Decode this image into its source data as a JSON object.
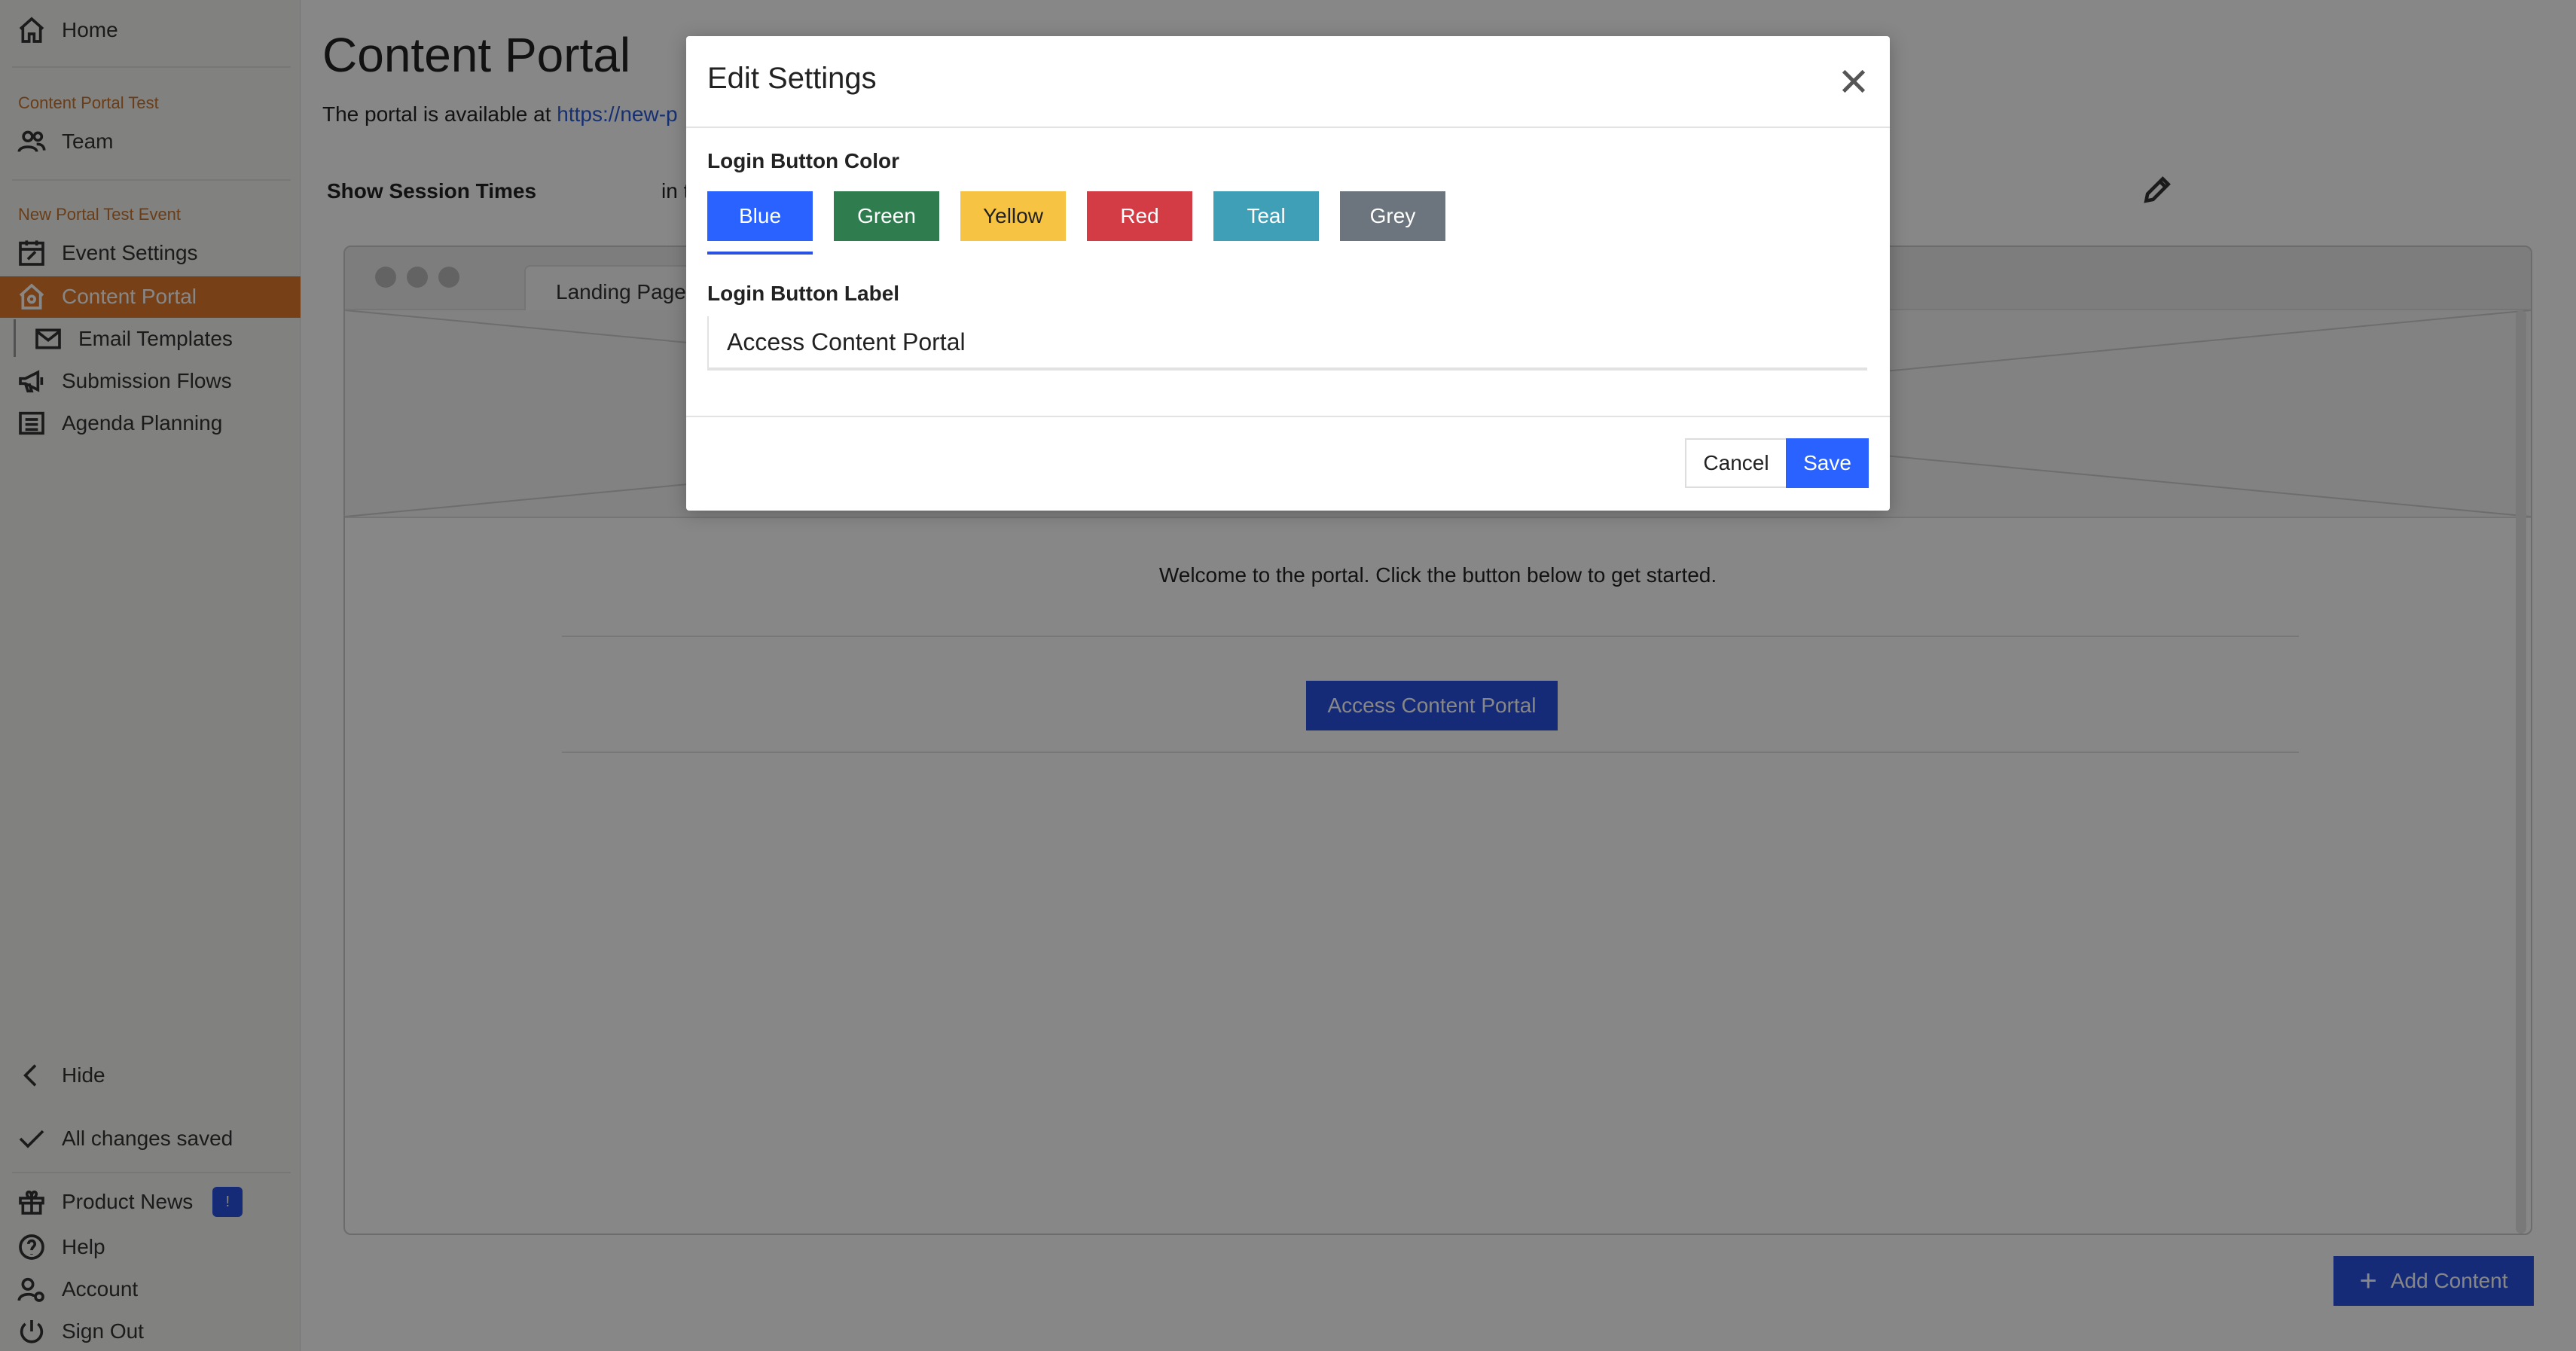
{
  "sidebar": {
    "home": "Home",
    "section1": "Content Portal Test",
    "team": "Team",
    "section2": "New Portal Test Event",
    "event_settings": "Event Settings",
    "content_portal": "Content Portal",
    "email_templates": "Email Templates",
    "submission_flows": "Submission Flows",
    "agenda_planning": "Agenda Planning",
    "hide": "Hide",
    "saved_status": "All changes saved",
    "product_news": "Product News",
    "product_news_badge": "!",
    "help": "Help",
    "account": "Account",
    "sign_out": "Sign Out",
    "accent_color": "#e07a2c"
  },
  "main": {
    "title": "Content Portal",
    "portal_text": "The portal is available at ",
    "portal_link": "https://new-p",
    "session_label": "Show Session Times",
    "session_in": "in t",
    "preview": {
      "tab_label": "Landing Page",
      "welcome_text": "Welcome to the portal. Click the button below to get started.",
      "portal_button": "Access Content Portal"
    },
    "add_content_button": "Add Content"
  },
  "modal": {
    "title": "Edit Settings",
    "color_label": "Login Button Color",
    "colors": [
      {
        "label": "Blue",
        "hex": "#2962ff",
        "text": "#ffffff"
      },
      {
        "label": "Green",
        "hex": "#2f7d4e",
        "text": "#ffffff"
      },
      {
        "label": "Yellow",
        "hex": "#f6c343",
        "text": "#222222"
      },
      {
        "label": "Red",
        "hex": "#d33b45",
        "text": "#ffffff"
      },
      {
        "label": "Teal",
        "hex": "#3e9fb7",
        "text": "#ffffff"
      },
      {
        "label": "Grey",
        "hex": "#6c757d",
        "text": "#ffffff"
      }
    ],
    "selected_color": "Blue",
    "label_field_label": "Login Button Label",
    "label_value": "Access Content Portal",
    "cancel": "Cancel",
    "save": "Save"
  }
}
